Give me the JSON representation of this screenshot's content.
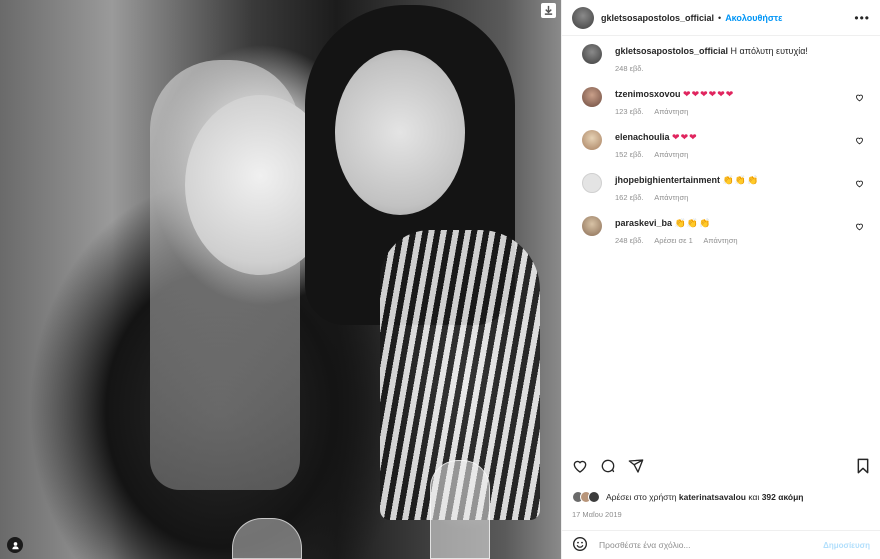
{
  "post": {
    "username": "gkletsosapostolos_official",
    "follow_label": "Ακολουθήστε",
    "separator": "•",
    "more_label": "•••"
  },
  "caption": {
    "username": "gkletsosapostolos_official",
    "text": "Η απόλυτη ευτυχία!",
    "time": "248 εβδ."
  },
  "comments": [
    {
      "username": "tzenimosxovou",
      "text": "❤❤❤❤❤❤",
      "time": "123 εβδ.",
      "likes": "",
      "reply": "Απάντηση"
    },
    {
      "username": "elenachoulia",
      "text": "❤❤❤",
      "time": "152 εβδ.",
      "likes": "",
      "reply": "Απάντηση"
    },
    {
      "username": "jhopebighientertainment",
      "text": "👏👏👏",
      "time": "162 εβδ.",
      "likes": "",
      "reply": "Απάντηση"
    },
    {
      "username": "paraskevi_ba",
      "text": "👏👏👏",
      "time": "248 εβδ.",
      "likes": "Αρέσει σε 1",
      "reply": "Απάντηση"
    }
  ],
  "likes": {
    "prefix": "Αρέσει στο χρήστη",
    "user": "katerinatsavalou",
    "and": "και",
    "more": "392 ακόμη"
  },
  "date": "17 Μαΐου 2019",
  "add_comment": {
    "placeholder": "Προσθέστε ένα σχόλιο...",
    "post_label": "Δημοσίευση"
  },
  "icons": {
    "download": "download-icon",
    "user_tag": "user-tag-icon",
    "heart": "heart-icon",
    "comment": "comment-icon",
    "share": "share-icon",
    "bookmark": "bookmark-icon",
    "emoji": "emoji-icon"
  },
  "colors": {
    "follow_blue": "#0095f6",
    "post_disabled": "#b2dffc",
    "meta_gray": "#8e8e8e",
    "heart_red": "#e0245e"
  }
}
